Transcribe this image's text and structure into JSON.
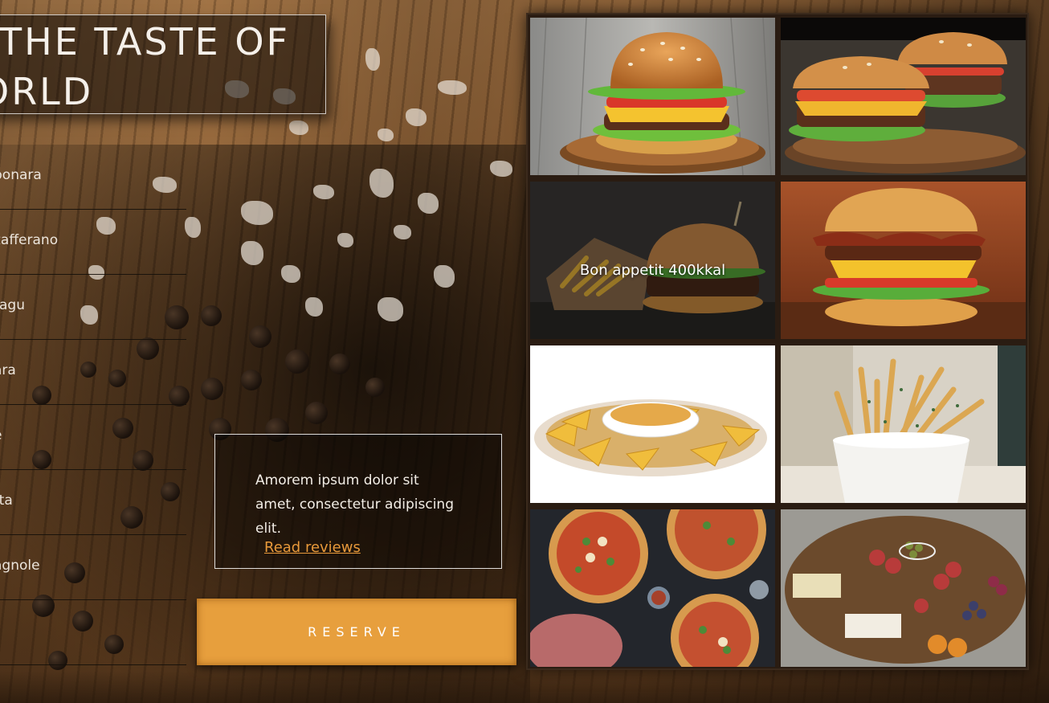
{
  "hero": {
    "title_line1": "THE TASTE OF",
    "title_line2": "ORLD"
  },
  "menu": {
    "items": [
      {
        "label": "bonara"
      },
      {
        "label": "zafferano"
      },
      {
        "label": "ragu"
      },
      {
        "label": "ara"
      },
      {
        "label": "e"
      },
      {
        "label": "tta"
      },
      {
        "label": "agnole"
      },
      {
        "label": ""
      }
    ]
  },
  "review": {
    "text": "Amorem ipsum dolor sit amet, consectetur adipiscing elit.",
    "link_label": "Read reviews"
  },
  "reserve": {
    "label": "RESERVE"
  },
  "gallery": {
    "tiles": [
      {
        "image": "burger-on-wooden-board-photo",
        "caption": ""
      },
      {
        "image": "two-burgers-on-board-photo",
        "caption": ""
      },
      {
        "image": "burger-and-fries-photo",
        "caption": "Bon appetit 400kkal"
      },
      {
        "image": "bacon-cheeseburger-photo",
        "caption": ""
      },
      {
        "image": "nachos-with-cheese-dip-photo",
        "caption": ""
      },
      {
        "image": "french-fries-cup-photo",
        "caption": ""
      },
      {
        "image": "pizzas-spread-photo",
        "caption": ""
      },
      {
        "image": "charcuterie-board-photo",
        "caption": ""
      }
    ]
  },
  "colors": {
    "accent": "#e79f3d",
    "link": "#e8993a",
    "text": "#f2ede6"
  }
}
